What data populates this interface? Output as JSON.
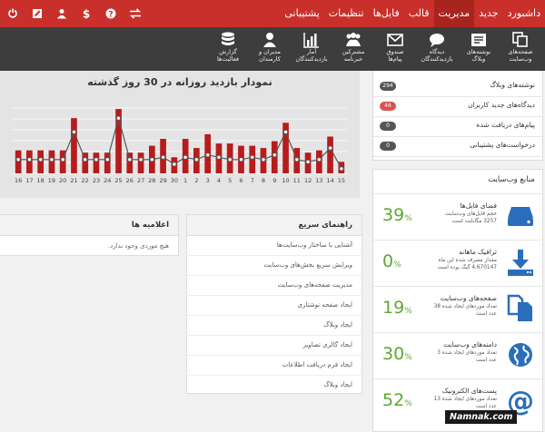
{
  "topbar": {
    "tabs": [
      {
        "label": "داشبورد",
        "active": false
      },
      {
        "label": "جدید",
        "active": false
      },
      {
        "label": "مدیریت",
        "active": true
      },
      {
        "label": "قالب",
        "active": false
      },
      {
        "label": "فایل‌ها",
        "active": false
      },
      {
        "label": "تنظیمات",
        "active": false
      },
      {
        "label": "پشتیبانی",
        "active": false
      }
    ],
    "icons": [
      "power-icon",
      "edit-icon",
      "user-icon",
      "dollar-icon",
      "help-icon",
      "swap-icon"
    ]
  },
  "toolbar": {
    "items": [
      {
        "name": "tool-pages",
        "label1": "صفحه‌های",
        "label2": "وب‌سایت",
        "icon": "copy-icon"
      },
      {
        "name": "tool-blog",
        "label1": "نوشته‌های",
        "label2": "وبلاگ",
        "icon": "blog-icon"
      },
      {
        "name": "tool-comments",
        "label1": "دیدگاه",
        "label2": "بازدیدکنندگان",
        "icon": "comments-icon"
      },
      {
        "name": "tool-inbox",
        "label1": "صندوق",
        "label2": "پیام‌ها",
        "icon": "envelope-icon"
      },
      {
        "name": "tool-subscribers",
        "label1": "مشترکین",
        "label2": "خبرنامه",
        "icon": "group-icon"
      },
      {
        "name": "tool-stats",
        "label1": "آمار",
        "label2": "بازدیدکنندگان",
        "icon": "bar-chart-icon"
      },
      {
        "name": "tool-admins",
        "label1": "مدیران و",
        "label2": "کارمندان",
        "icon": "person-icon"
      },
      {
        "name": "tool-reports",
        "label1": "گزارش",
        "label2": "فعالیت‌ها",
        "icon": "database-icon"
      }
    ]
  },
  "notifications": [
    {
      "label": "نوشته‌های وبلاگ",
      "count": "294",
      "color": "#555555"
    },
    {
      "label": "دیدگاه‌های جدید کاربران",
      "count": "46",
      "color": "#d9534f"
    },
    {
      "label": "پیام‌های دریافت شده",
      "count": "0",
      "color": "#555555"
    },
    {
      "label": "درخواست‌های پشتیبانی",
      "count": "0",
      "color": "#555555"
    }
  ],
  "resources": {
    "title": "منابع وب‌سایت",
    "items": [
      {
        "title": "فضای فایل‌ها",
        "desc": "حجم فایل‌های وب‌سایت 3257 مگابایت است",
        "pct": "39",
        "icon": "hdd-icon"
      },
      {
        "title": "ترافیک ماهانه",
        "desc": "مقدار مصرف شده این ماه 4.670147 گیگ بوده است",
        "pct": "0",
        "icon": "download-icon"
      },
      {
        "title": "صفحه‌های وب‌سایت",
        "desc": "تعداد موردهای ایجاد شده 38 عدد است",
        "pct": "19",
        "icon": "pages-icon"
      },
      {
        "title": "دامنه‌های وب‌سایت",
        "desc": "تعداد موردهای ایجاد شده 3 عدد است",
        "pct": "30",
        "icon": "globe-icon"
      },
      {
        "title": "پست‌های الکترونیک",
        "desc": "تعداد موردهای ایجاد شده 13 عدد است",
        "pct": "52",
        "icon": "at-icon"
      }
    ],
    "pct_sign": "%"
  },
  "guide": {
    "title": "راهنمای سریع",
    "items": [
      "آشنایی با ساختار وب‌سایت‌ها",
      "ویرایش سریع بخش‌های وب‌سایت",
      "مدیریت صفحه‌های وب‌سایت",
      "ایجاد صفحه نوشتاری",
      "ایجاد وبلاگ",
      "ایجاد گالری تصاویر",
      "ایجاد فرم دریافت اطلاعات",
      "ایجاد وبلاگ"
    ]
  },
  "announcements": {
    "title": "اعلامیه ها",
    "empty": "هیچ موردی وجود ندارد."
  },
  "watermark": "Namnak.com",
  "colors": {
    "topbar": "#c9302c",
    "bar": "#b71c1c",
    "line": "#555555",
    "green": "#5aa832",
    "icon_blue": "#2a6ebb"
  },
  "chart_data": {
    "type": "bar",
    "title": "نمودار بازدید روزانه در 30 روز گذشته",
    "categories": [
      "16",
      "17",
      "18",
      "19",
      "20",
      "21",
      "22",
      "23",
      "24",
      "25",
      "26",
      "27",
      "28",
      "29",
      "30",
      "1",
      "2",
      "3",
      "4",
      "5",
      "6",
      "7",
      "8",
      "9",
      "10",
      "11",
      "12",
      "13",
      "14",
      "15"
    ],
    "series": [
      {
        "values": [
          10,
          10,
          10,
          10,
          10,
          24,
          9,
          9,
          9,
          28,
          9,
          9,
          12,
          15,
          7,
          15,
          11,
          17,
          13,
          13,
          12,
          12,
          11,
          14,
          22,
          11,
          9,
          10,
          16,
          5
        ]
      },
      {
        "values": [
          6,
          6,
          6,
          6,
          6,
          18,
          6,
          6,
          6,
          24,
          6,
          6,
          6,
          7,
          4,
          7,
          6,
          8,
          7,
          6,
          6,
          7,
          6,
          8,
          18,
          6,
          5,
          6,
          11,
          2
        ]
      }
    ],
    "ylim": [
      0,
      30
    ]
  }
}
